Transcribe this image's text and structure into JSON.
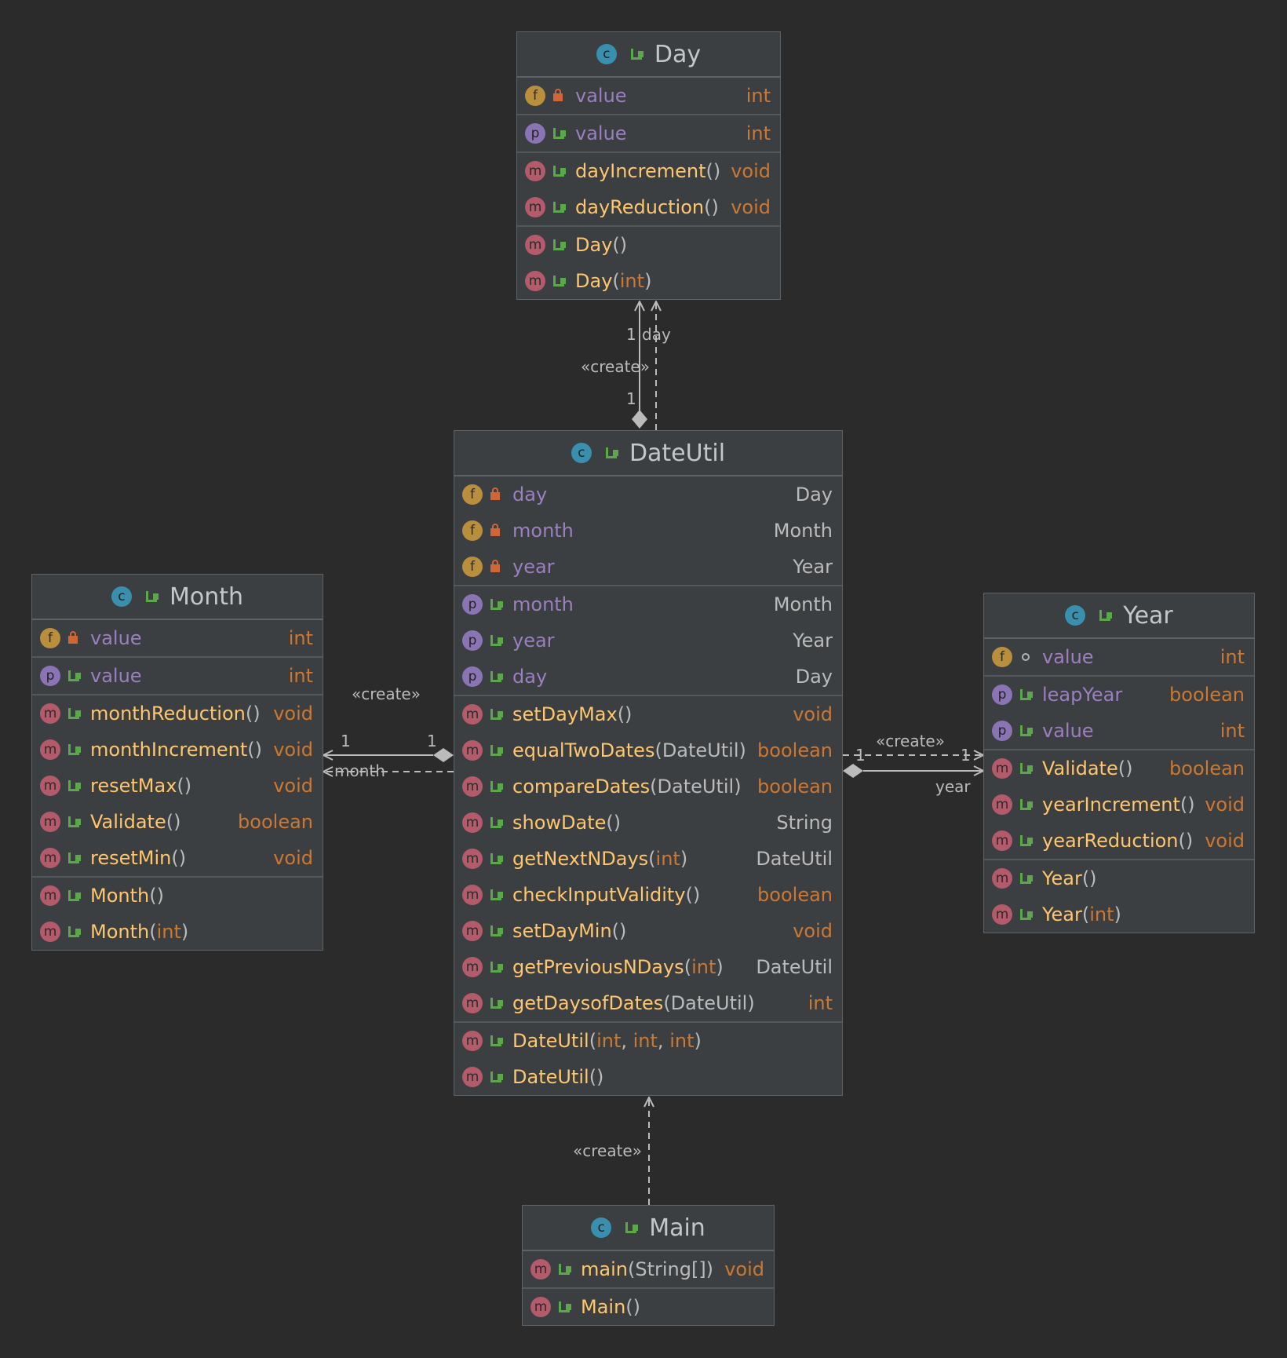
{
  "diagram": {
    "classes": {
      "day": {
        "name": "Day",
        "sections": [
          [
            {
              "kind": "f",
              "vis": "priv",
              "name": "value",
              "type": "int"
            }
          ],
          [
            {
              "kind": "p",
              "vis": "pub",
              "name": "value",
              "type": "int"
            }
          ],
          [
            {
              "kind": "m",
              "vis": "pub",
              "name": "dayIncrement",
              "params": "()",
              "type": "void"
            },
            {
              "kind": "m",
              "vis": "pub",
              "name": "dayReduction",
              "params": " ()",
              "type": "void"
            }
          ],
          [
            {
              "kind": "m",
              "vis": "pub",
              "name": "Day",
              "params": "()",
              "type": ""
            },
            {
              "kind": "m",
              "vis": "pub",
              "name": "Day",
              "params": "(int)",
              "type": ""
            }
          ]
        ]
      },
      "dateutil": {
        "name": "DateUtil",
        "sections": [
          [
            {
              "kind": "f",
              "vis": "priv",
              "name": "day",
              "type": "Day"
            },
            {
              "kind": "f",
              "vis": "priv",
              "name": "month",
              "type": "Month"
            },
            {
              "kind": "f",
              "vis": "priv",
              "name": "year",
              "type": "Year"
            }
          ],
          [
            {
              "kind": "p",
              "vis": "pub",
              "name": "month",
              "type": "Month"
            },
            {
              "kind": "p",
              "vis": "pub",
              "name": "year",
              "type": "Year"
            },
            {
              "kind": "p",
              "vis": "pub",
              "name": "day",
              "type": "Day"
            }
          ],
          [
            {
              "kind": "m",
              "vis": "pub",
              "name": "setDayMax",
              "params": "()",
              "type": "void"
            },
            {
              "kind": "m",
              "vis": "pub",
              "name": "equalTwoDates",
              "params": "(DateUtil)",
              "type": "boolean"
            },
            {
              "kind": "m",
              "vis": "pub",
              "name": "compareDates",
              "params": " (DateUtil)",
              "type": "boolean"
            },
            {
              "kind": "m",
              "vis": "pub",
              "name": "showDate",
              "params": "()",
              "type": "String"
            },
            {
              "kind": "m",
              "vis": "pub",
              "name": "getNextNDays",
              "params": "(int)",
              "type": "DateUtil"
            },
            {
              "kind": "m",
              "vis": "pub",
              "name": "checkInputValidity",
              "params": " ()",
              "type": "boolean"
            },
            {
              "kind": "m",
              "vis": "pub",
              "name": "setDayMin",
              "params": "()",
              "type": "void"
            },
            {
              "kind": "m",
              "vis": "pub",
              "name": "getPreviousNDays",
              "params": "(int)",
              "type": "DateUtil"
            },
            {
              "kind": "m",
              "vis": "pub",
              "name": "getDaysofDates",
              "params": "(DateUtil)",
              "type": "int"
            }
          ],
          [
            {
              "kind": "m",
              "vis": "pub",
              "name": "DateUtil",
              "params": "(int, int, int)",
              "type": ""
            },
            {
              "kind": "m",
              "vis": "pub",
              "name": "DateUtil",
              "params": "()",
              "type": ""
            }
          ]
        ]
      },
      "month": {
        "name": "Month",
        "sections": [
          [
            {
              "kind": "f",
              "vis": "priv",
              "name": "value",
              "type": "int"
            }
          ],
          [
            {
              "kind": "p",
              "vis": "pub",
              "name": "value",
              "type": "int"
            }
          ],
          [
            {
              "kind": "m",
              "vis": "pub",
              "name": "monthReduction",
              "params": " ()",
              "type": "void"
            },
            {
              "kind": "m",
              "vis": "pub",
              "name": "monthIncrement",
              "params": " ()",
              "type": "void"
            },
            {
              "kind": "m",
              "vis": "pub",
              "name": "resetMax",
              "params": " ()",
              "type": "void"
            },
            {
              "kind": "m",
              "vis": "pub",
              "name": "Validate",
              "params": " ()",
              "type": "boolean"
            },
            {
              "kind": "m",
              "vis": "pub",
              "name": "resetMin",
              "params": " ()",
              "type": "void"
            }
          ],
          [
            {
              "kind": "m",
              "vis": "pub",
              "name": "Month",
              "params": "()",
              "type": ""
            },
            {
              "kind": "m",
              "vis": "pub",
              "name": "Month",
              "params": "(int)",
              "type": ""
            }
          ]
        ]
      },
      "year": {
        "name": "Year",
        "sections": [
          [
            {
              "kind": "f",
              "vis": "pkg",
              "name": "value",
              "type": "int"
            }
          ],
          [
            {
              "kind": "p",
              "vis": "pub",
              "name": "leapYear",
              "type": "boolean"
            },
            {
              "kind": "p",
              "vis": "pub",
              "name": "value",
              "type": "int"
            }
          ],
          [
            {
              "kind": "m",
              "vis": "pub",
              "name": "Validate",
              "params": " ()",
              "type": "boolean"
            },
            {
              "kind": "m",
              "vis": "pub",
              "name": "yearIncrement",
              "params": " ()",
              "type": "void"
            },
            {
              "kind": "m",
              "vis": "pub",
              "name": "yearReduction",
              "params": " ()",
              "type": "void"
            }
          ],
          [
            {
              "kind": "m",
              "vis": "pub",
              "name": "Year",
              "params": "()",
              "type": ""
            },
            {
              "kind": "m",
              "vis": "pub",
              "name": "Year",
              "params": "(int)",
              "type": ""
            }
          ]
        ]
      },
      "main": {
        "name": "Main",
        "sections": [
          [
            {
              "kind": "m",
              "vis": "pub",
              "name": "main",
              "params": "(String[])",
              "type": "void"
            }
          ],
          [
            {
              "kind": "m",
              "vis": "pub",
              "name": "Main",
              "params": "()",
              "type": ""
            }
          ]
        ]
      }
    },
    "labels": {
      "day_create": "«create»",
      "day_mult_top": "1",
      "day_role": "day",
      "day_mult_bottom": "1",
      "month_create": "«create»",
      "month_mult_left": "1",
      "month_mult_right": "1",
      "month_role": "month",
      "year_create": "«create»",
      "year_mult_left": "1",
      "year_mult_right": "1",
      "year_role": "year",
      "main_create": "«create»"
    },
    "colors": {
      "background": "#2b2b2b",
      "class_fill": "#3c3f41",
      "field": "#9c7fbf",
      "method": "#ffc66d",
      "primitive_type": "#cc7832",
      "object_type": "#bbbbbb",
      "public_icon": "#5aa84a",
      "private_icon": "#d06535"
    }
  }
}
